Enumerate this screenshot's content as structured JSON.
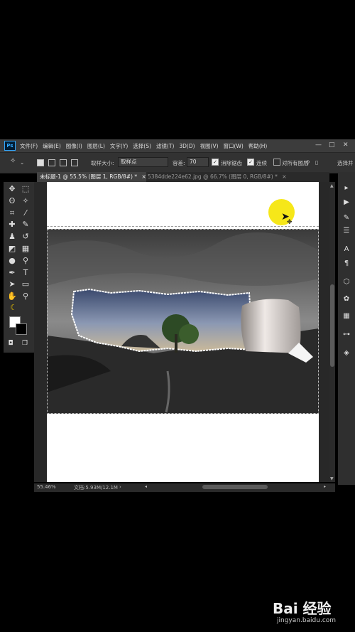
{
  "app": {
    "logo": "Ps"
  },
  "menu": [
    "文件(F)",
    "编辑(E)",
    "图像(I)",
    "图层(L)",
    "文字(Y)",
    "选择(S)",
    "滤镜(T)",
    "3D(D)",
    "视图(V)",
    "窗口(W)",
    "帮助(H)"
  ],
  "window_controls": {
    "minimize": "—",
    "maximize": "□",
    "close": "✕"
  },
  "options": {
    "sample_size_label": "取样大小:",
    "sample_size_value": "取样点",
    "tolerance_label": "容差:",
    "tolerance_value": "70",
    "anti_alias": {
      "label": "消除锯齿",
      "checked": true
    },
    "contiguous": {
      "label": "连续",
      "checked": true
    },
    "all_layers": {
      "label": "对所有图层",
      "checked": false
    },
    "select_subject": "选择并"
  },
  "tabs": [
    {
      "label": "未标题-1 @ 55.5% (图层 1, RGB/8#) *",
      "close": "×",
      "active": true
    },
    {
      "label": "5384dde224e62.jpg @ 66.7% (图层 0, RGB/8#) *",
      "close": "×",
      "active": false
    }
  ],
  "status": {
    "zoom": "55.46%",
    "doc": "文档:5.93M/12.1M"
  },
  "tools": [
    {
      "name": "move-tool",
      "glyph": "✥"
    },
    {
      "name": "marquee-tool",
      "glyph": "⬚"
    },
    {
      "name": "lasso-tool",
      "glyph": "ʘ"
    },
    {
      "name": "magic-wand-tool",
      "glyph": "✧"
    },
    {
      "name": "crop-tool",
      "glyph": "⌗"
    },
    {
      "name": "eyedropper-tool",
      "glyph": "⁄"
    },
    {
      "name": "healing-tool",
      "glyph": "✚"
    },
    {
      "name": "brush-tool",
      "glyph": "✎"
    },
    {
      "name": "stamp-tool",
      "glyph": "♟"
    },
    {
      "name": "history-brush-tool",
      "glyph": "↺"
    },
    {
      "name": "eraser-tool",
      "glyph": "◩"
    },
    {
      "name": "gradient-tool",
      "glyph": "▦"
    },
    {
      "name": "blur-tool",
      "glyph": "●"
    },
    {
      "name": "dodge-tool",
      "glyph": "⚲"
    },
    {
      "name": "pen-tool",
      "glyph": "✒"
    },
    {
      "name": "type-tool",
      "glyph": "T"
    },
    {
      "name": "path-select-tool",
      "glyph": "➤"
    },
    {
      "name": "shape-tool",
      "glyph": "▭"
    },
    {
      "name": "hand-tool",
      "glyph": "✋"
    },
    {
      "name": "zoom-tool",
      "glyph": "⚲"
    }
  ],
  "colors": {
    "foreground": "#ffffff",
    "background": "#000000",
    "accent": "#31a8ff",
    "cursor_highlight": "#f5e400"
  },
  "dock_icons": [
    "play-icon",
    "brush-settings-icon",
    "adjust-icon",
    "character-icon",
    "paragraph-icon",
    "3d-icon",
    "color-icon",
    "swatches-icon",
    "paths-icon",
    "layers-icon"
  ],
  "watermark": {
    "brand": "Bai 经验",
    "url": "jingyan.baidu.com"
  }
}
